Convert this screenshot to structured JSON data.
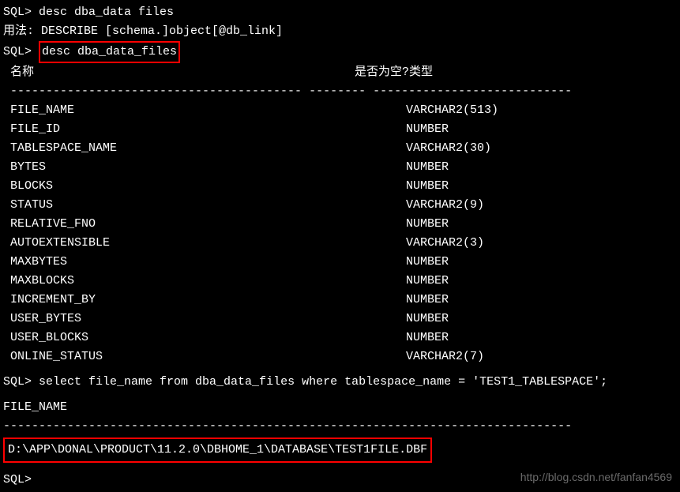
{
  "cmd1": {
    "prompt": "SQL> ",
    "command": "desc dba_data files"
  },
  "usage": "用法: DESCRIBE [schema.]object[@db_link]",
  "cmd2": {
    "prompt": "SQL> ",
    "command": "desc dba_data_files"
  },
  "headers": {
    "name_label": " 名称",
    "null_label": "是否为空?",
    "type_label": " 类型"
  },
  "dashes": {
    "col1": " ----------------------------------------- -------- ----------------------------",
    "result": "--------------------------------------------------------------------------------"
  },
  "columns": [
    {
      "name": " FILE_NAME",
      "type": "VARCHAR2(513)"
    },
    {
      "name": " FILE_ID",
      "type": "NUMBER"
    },
    {
      "name": " TABLESPACE_NAME",
      "type": "VARCHAR2(30)"
    },
    {
      "name": " BYTES",
      "type": "NUMBER"
    },
    {
      "name": " BLOCKS",
      "type": "NUMBER"
    },
    {
      "name": " STATUS",
      "type": "VARCHAR2(9)"
    },
    {
      "name": " RELATIVE_FNO",
      "type": "NUMBER"
    },
    {
      "name": " AUTOEXTENSIBLE",
      "type": "VARCHAR2(3)"
    },
    {
      "name": " MAXBYTES",
      "type": "NUMBER"
    },
    {
      "name": " MAXBLOCKS",
      "type": "NUMBER"
    },
    {
      "name": " INCREMENT_BY",
      "type": "NUMBER"
    },
    {
      "name": " USER_BYTES",
      "type": "NUMBER"
    },
    {
      "name": " USER_BLOCKS",
      "type": "NUMBER"
    },
    {
      "name": " ONLINE_STATUS",
      "type": "VARCHAR2(7)"
    }
  ],
  "cmd3": {
    "prompt": "SQL> ",
    "command": "select file_name from dba_data_files where tablespace_name = 'TEST1_TABLESPACE';"
  },
  "result": {
    "header": "FILE_NAME",
    "value": "D:\\APP\\DONAL\\PRODUCT\\11.2.0\\DBHOME_1\\DATABASE\\TEST1FILE.DBF"
  },
  "cmd4": {
    "prompt": "SQL>"
  },
  "watermark": "http://blog.csdn.net/fanfan4569"
}
